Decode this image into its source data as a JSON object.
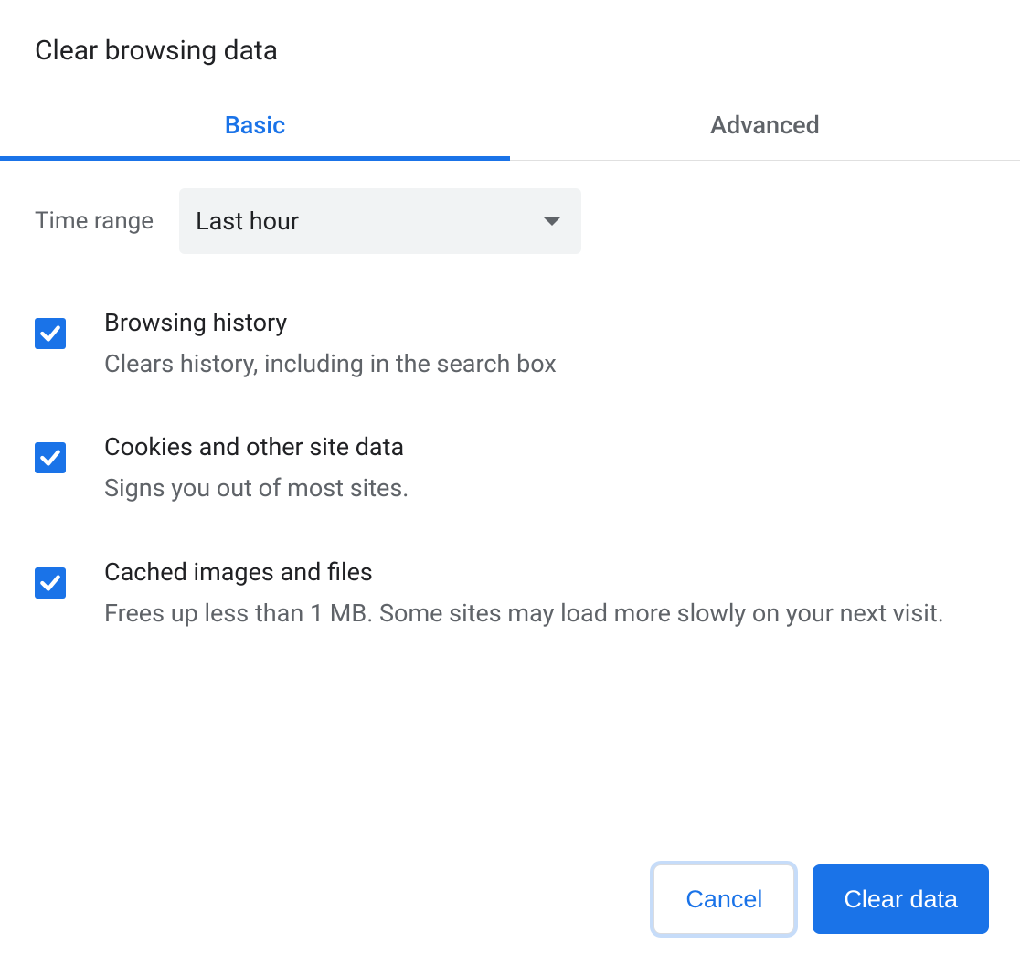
{
  "dialog": {
    "title": "Clear browsing data",
    "tabs": {
      "basic": "Basic",
      "advanced": "Advanced"
    },
    "timeRange": {
      "label": "Time range",
      "value": "Last hour"
    },
    "options": [
      {
        "title": "Browsing history",
        "desc": "Clears history, including in the search box",
        "checked": true
      },
      {
        "title": "Cookies and other site data",
        "desc": "Signs you out of most sites.",
        "checked": true
      },
      {
        "title": "Cached images and files",
        "desc": "Frees up less than 1 MB. Some sites may load more slowly on your next visit.",
        "checked": true
      }
    ],
    "buttons": {
      "cancel": "Cancel",
      "clear": "Clear data"
    }
  }
}
